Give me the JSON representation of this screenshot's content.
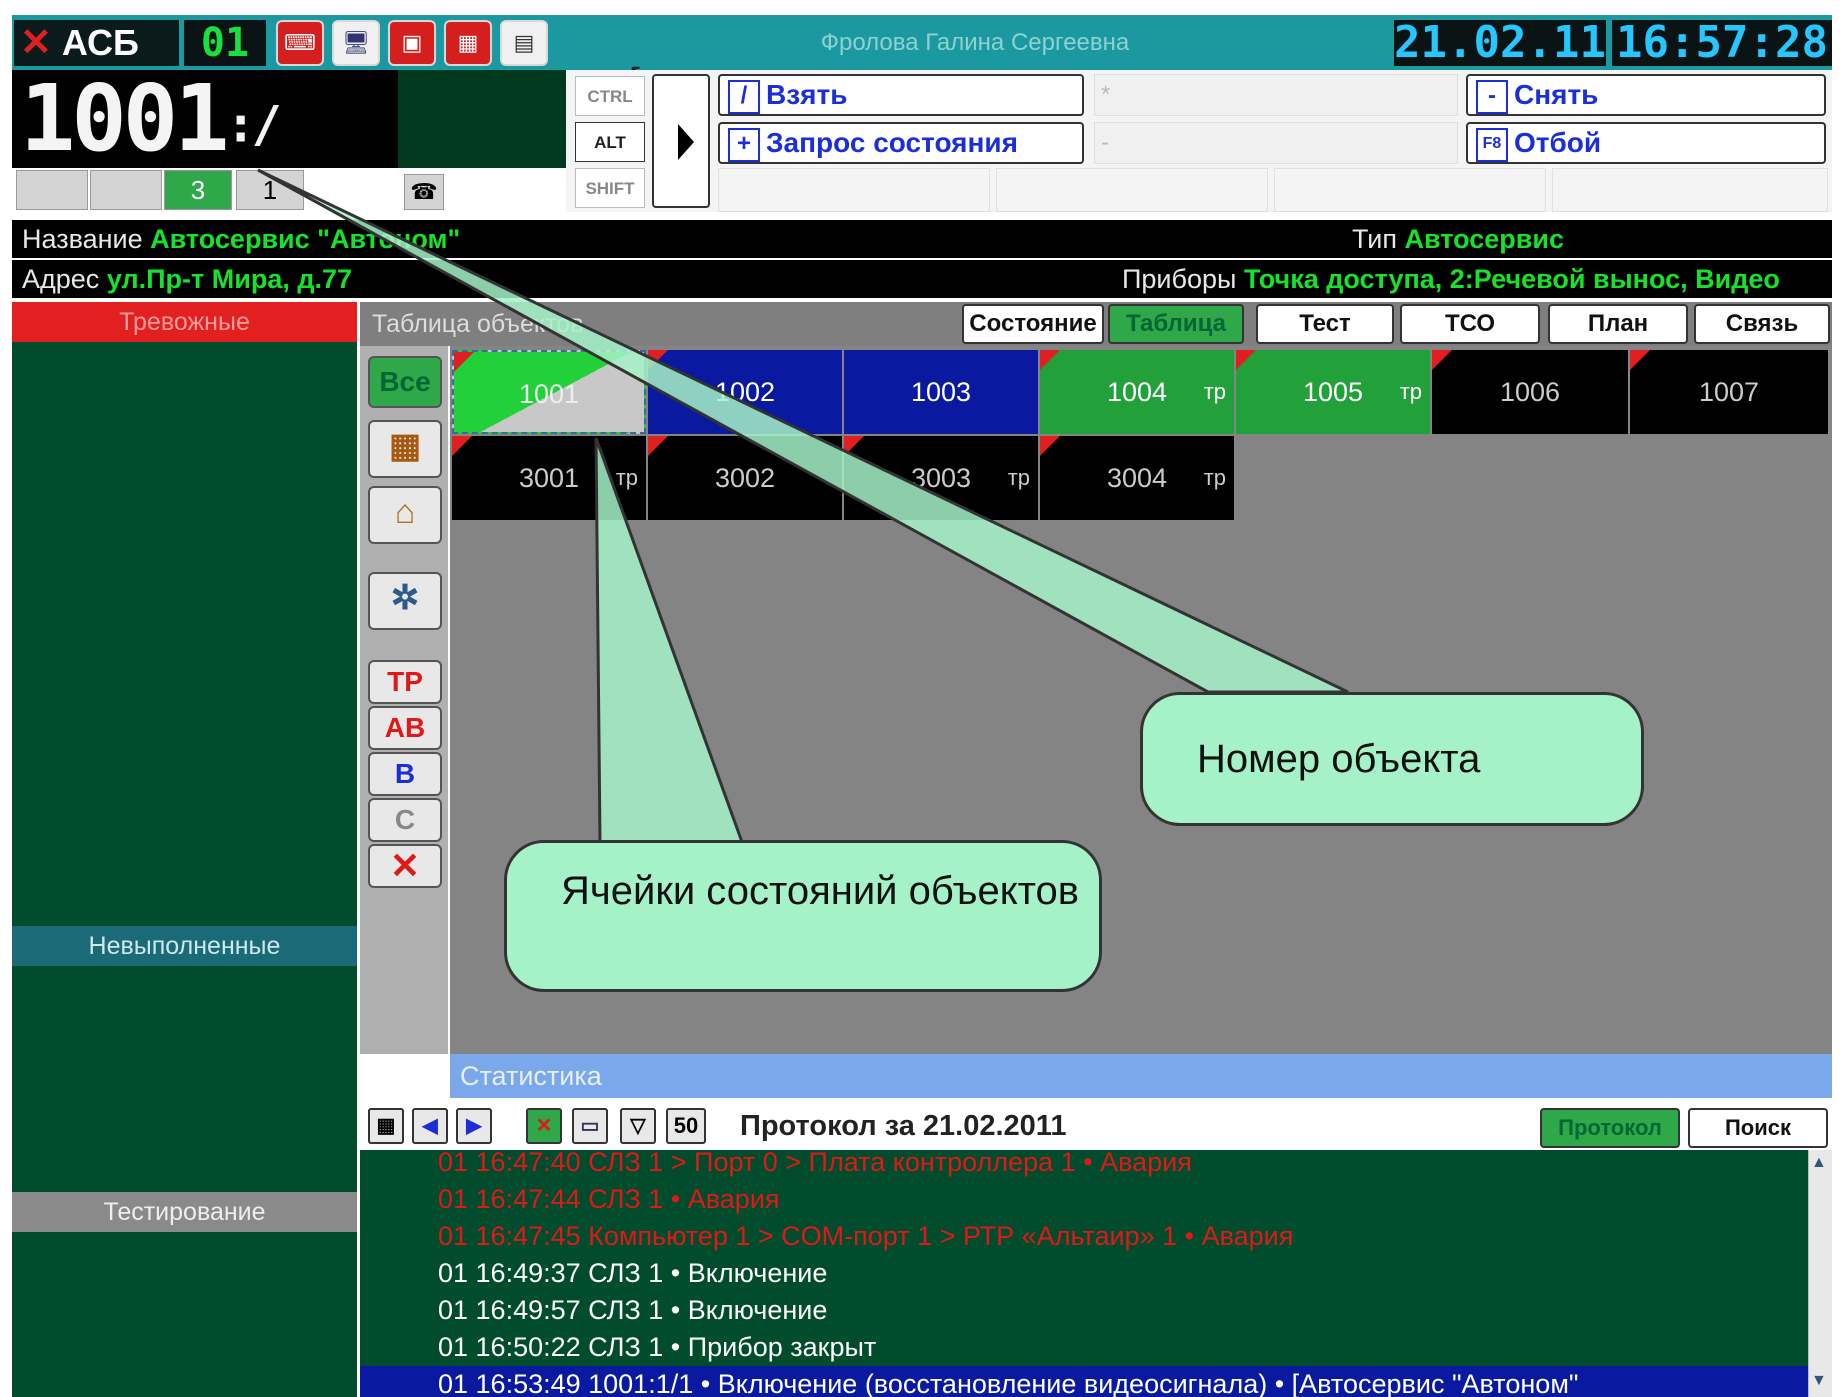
{
  "topbar": {
    "logo": "АСБ",
    "console_no": "01",
    "operator": "Фролова Галина Сергеевна",
    "date": "21.02.11",
    "time": "16:57:28"
  },
  "display": {
    "object": "1001",
    "separator": ":",
    "partition": "",
    "slash": "/",
    "counter_a": "3",
    "counter_b": "1"
  },
  "modifiers": {
    "ctrl": "CTRL",
    "alt": "ALT",
    "shift": "SHIFT"
  },
  "commands": {
    "take_key": "/",
    "take": "Взять",
    "status_key": "+",
    "status": "Запрос состояния",
    "star_key": "*",
    "minus_key": "-",
    "remove_key": "-",
    "remove": "Снять",
    "reject_key": "F8",
    "reject": "Отбой"
  },
  "info": {
    "name_label": "Название",
    "name_value": "Автосервис \"Автоном\"",
    "type_label": "Тип",
    "type_value": "Автосервис",
    "address_label": "Адрес",
    "address_value": "ул.Пр-т Мира, д.77",
    "devices_label": "Приборы",
    "devices_value": "Точка доступа, 2:Речевой вынос, Видео"
  },
  "left": {
    "alarms": "Тревожные",
    "unfinished": "Невыполненные",
    "testing": "Тестирование"
  },
  "table": {
    "title": "Таблица объектов",
    "tabs": [
      "Состояние",
      "Таблица",
      "Тест",
      "ТСО",
      "План",
      "Связь"
    ],
    "active_tab": "Таблица",
    "filters": {
      "all": "Все",
      "tr": "ТР",
      "av": "АВ",
      "b": "В",
      "c": "С"
    },
    "row1": [
      {
        "num": "1001",
        "tag": ""
      },
      {
        "num": "1002",
        "tag": ""
      },
      {
        "num": "1003",
        "tag": ""
      },
      {
        "num": "1004",
        "tag": "тр"
      },
      {
        "num": "1005",
        "tag": "тр"
      },
      {
        "num": "1006",
        "tag": ""
      },
      {
        "num": "1007",
        "tag": ""
      }
    ],
    "row2": [
      {
        "num": "3001",
        "tag": "тр"
      },
      {
        "num": "3002",
        "tag": ""
      },
      {
        "num": "3003",
        "tag": "тр"
      },
      {
        "num": "3004",
        "tag": "тр"
      }
    ],
    "colors": {
      "green": "#22a13a",
      "blue": "#0a1aa0",
      "black": "#000000",
      "selected_grey": "#c8c8c8"
    }
  },
  "stats": {
    "title": "Статистика"
  },
  "protocol": {
    "title": "Протокол за 21.02.2011",
    "count": "50",
    "btn_protocol": "Протокол",
    "btn_search": "Поиск",
    "rows": [
      {
        "text": "01  16:47:40  СЛЗ 1 > Порт 0 > Плата контроллера 1 • Авария",
        "color": "#e01818"
      },
      {
        "text": "01  16:47:44  СЛЗ 1 • Авария",
        "color": "#e01818"
      },
      {
        "text": "01  16:47:45  Компьютер 1 > COM-порт 1 > РТР «Альтаир» 1 • Авария",
        "color": "#e01818"
      },
      {
        "text": "01  16:49:37  СЛЗ 1 • Включение",
        "color": "#ffffff"
      },
      {
        "text": "01  16:49:57  СЛЗ 1 • Включение",
        "color": "#ffffff"
      },
      {
        "text": "01  16:50:22  СЛЗ 1 • Прибор закрыт",
        "color": "#ffffff"
      },
      {
        "text": "01  16:53:49  1001:1/1 • Включение (восстановление видеосигнала) •  [Автосервис \"Автоном\"",
        "color": "#ffffff",
        "selected": true
      }
    ]
  },
  "callouts": {
    "object_number": "Номер объекта",
    "state_cells": "Ячейки состояний объектов"
  }
}
